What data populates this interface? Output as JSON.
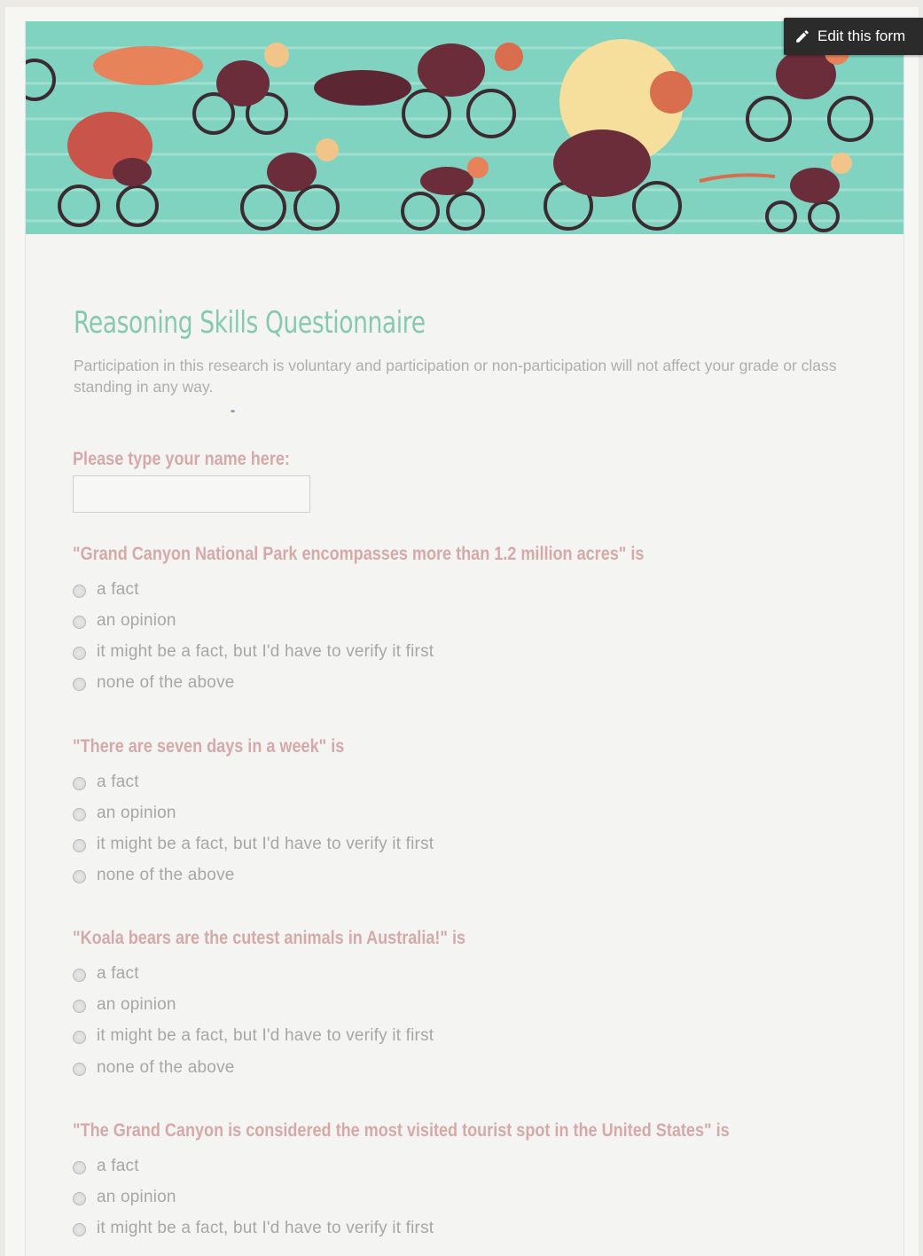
{
  "toolbar": {
    "edit_label": "Edit this form",
    "edit_icon": "pencil-icon"
  },
  "form": {
    "title": "Reasoning Skills Questionnaire",
    "description": "Participation in this research is voluntary and participation or non-participation will not affect your grade or class standing in any way.",
    "title_color": "#86c9b3",
    "question_color": "#d6a9a9"
  },
  "name_question": {
    "label": "Please type your name here:",
    "value": ""
  },
  "questions": [
    {
      "title": "\"Grand Canyon National Park encompasses more than 1.2 million acres\" is",
      "options": [
        "a fact",
        "an opinion",
        "it might be a fact, but I'd have to verify it first",
        "none of the above"
      ]
    },
    {
      "title": "\"There are seven days in a week\" is",
      "options": [
        "a fact",
        "an opinion",
        "it might be a fact, but I'd have to verify it first",
        "none of the above"
      ]
    },
    {
      "title": "\"Koala bears are the cutest animals in Australia!\" is",
      "options": [
        "a fact",
        "an opinion",
        "it might be a fact, but I'd have to verify it first",
        "none of the above"
      ]
    },
    {
      "title": "\"The Grand Canyon is considered the most visited tourist spot in the United States\" is",
      "options": [
        "a fact",
        "an opinion",
        "it might be a fact, but I'd have to verify it first"
      ]
    }
  ]
}
